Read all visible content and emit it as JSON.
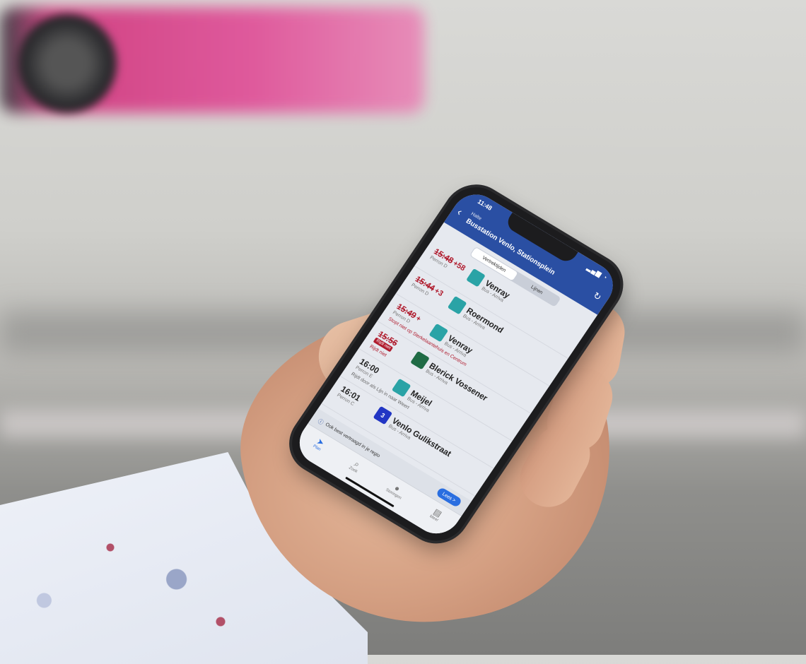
{
  "status_bar": {
    "time": "11:48",
    "icons": "▂▄▆ ◔"
  },
  "header": {
    "kicker": "Halte",
    "title": "Busstation Venlo, Stationsplein",
    "back_icon": "chevron-left-icon",
    "refresh_icon": "refresh-icon"
  },
  "segments": [
    {
      "label": "Vertrektijden",
      "active": true
    },
    {
      "label": "Lijnen",
      "active": false
    }
  ],
  "departures": [
    {
      "time": "15:48",
      "delay": "+58",
      "delayed": true,
      "platform": "Perron D",
      "line": "",
      "line_color": "#2aa3a6",
      "destination": "Venray",
      "operator": "Bus - Arriva",
      "note": "",
      "note_style": ""
    },
    {
      "time": "15:44",
      "delay": "+3",
      "delayed": true,
      "platform": "Perron D",
      "line": "",
      "line_color": "#2aa3a6",
      "destination": "Roermond",
      "operator": "Bus - Arriva",
      "note": "",
      "note_style": ""
    },
    {
      "time": "15:49",
      "delay": "+",
      "delayed": true,
      "platform": "Perron D",
      "line": "",
      "line_color": "#2aa3a6",
      "destination": "Venray",
      "operator": "Bus - Arriva",
      "note": "Stopt niet op Sterkelaantehuis en Centrum",
      "note_style": "red"
    },
    {
      "time": "15:56",
      "delay": "",
      "delayed": true,
      "platform": "",
      "cancel_tag": "Rijdt niet",
      "line": "",
      "line_color": "#1f6b45",
      "destination": "Blerick Vossener",
      "operator": "Bus - Arriva",
      "note": "Rijdt niet",
      "note_style": "red"
    },
    {
      "time": "16:00",
      "delay": "",
      "delayed": false,
      "platform": "Perron E",
      "line": "",
      "line_color": "#2aa3a6",
      "destination": "Meijel",
      "operator": "Bus - Arriva",
      "note": "Rijdt door als Lijn in naar Weert",
      "note_style": "grey"
    },
    {
      "time": "16:01",
      "delay": "",
      "delayed": false,
      "platform": "Perron C",
      "line": "3",
      "line_color": "#2236c4",
      "destination": "Venlo Gulikstraat",
      "operator": "Bus - Arriva",
      "note": "",
      "note_style": ""
    }
  ],
  "banner": {
    "text": "Ook best vertraagd in je regio",
    "button_label": "Lees >",
    "icon": "info-icon"
  },
  "tabs": [
    {
      "label": "Plan",
      "icon": "➤",
      "icon_name": "navigation-icon",
      "active": true
    },
    {
      "label": "Zoek",
      "icon": "⌕",
      "icon_name": "search-icon",
      "active": false
    },
    {
      "label": "Storingen",
      "icon": "●",
      "icon_name": "alert-icon",
      "active": false
    },
    {
      "label": "Meer",
      "icon": "▤",
      "icon_name": "menu-icon",
      "active": false
    }
  ]
}
